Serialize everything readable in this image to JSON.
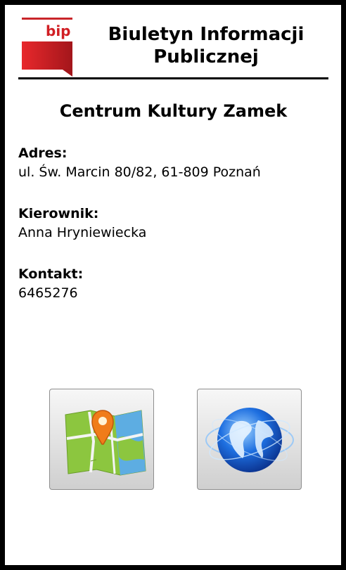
{
  "header": {
    "logo_text": "bip",
    "title": "Biuletyn Informacji Publicznej"
  },
  "organization": {
    "name": "Centrum Kultury Zamek"
  },
  "fields": {
    "address": {
      "label": "Adres:",
      "value": "ul. Św. Marcin 80/82, 61-809 Poznań"
    },
    "manager": {
      "label": "Kierownik:",
      "value": "Anna Hryniewiecka"
    },
    "contact": {
      "label": "Kontakt:",
      "value": "6465276"
    }
  },
  "buttons": {
    "map": {
      "icon": "map-pin-icon"
    },
    "web": {
      "icon": "globe-icon"
    }
  },
  "colors": {
    "bip_red": "#d11f24",
    "pin_orange": "#f07c1a",
    "map_green": "#8cc63f",
    "globe_blue": "#1e6fe0"
  }
}
